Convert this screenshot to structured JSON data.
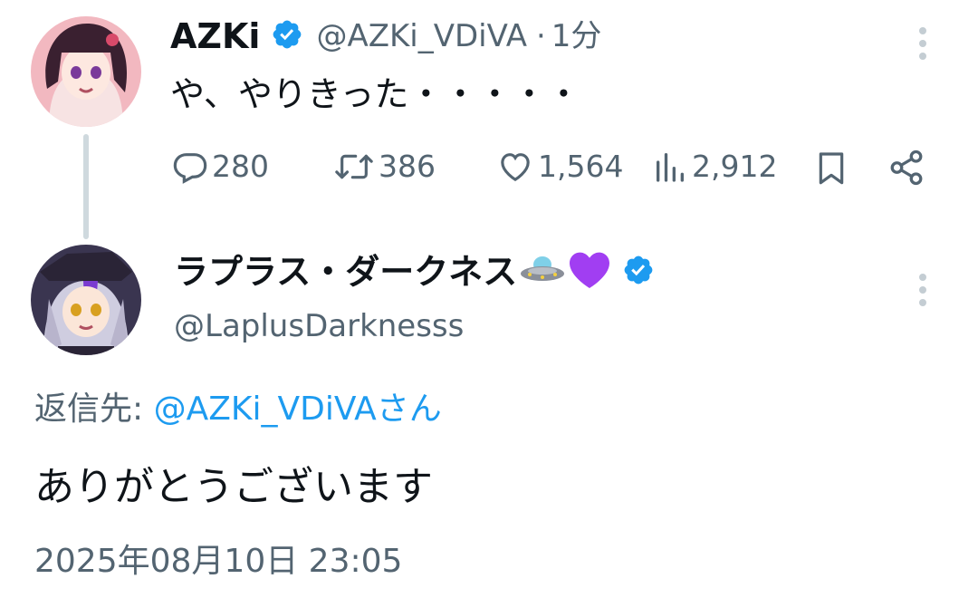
{
  "tweet1": {
    "display_name": "AZKi",
    "handle": "@AZKi_VDiVA",
    "separator": "·",
    "time": "1分",
    "text": "や、やりきった・・・・・",
    "stats": {
      "replies": "280",
      "retweets": "386",
      "likes": "1,564",
      "views": "2,912"
    }
  },
  "tweet2": {
    "display_name": "ラプラス・ダークネス",
    "name_emojis": [
      "ufo-emoji",
      "purple-heart-emoji"
    ],
    "handle": "@LaplusDarknesss",
    "reply_prefix": "返信先: ",
    "reply_target": "@AZKi_VDiVAさん",
    "text": "ありがとうございます",
    "timestamp": "2025年08月10日 23:05"
  },
  "colors": {
    "verified": "#1d9bf0",
    "muted": "#536471",
    "link": "#1d9bf0",
    "thread_line": "#cfd9de"
  }
}
